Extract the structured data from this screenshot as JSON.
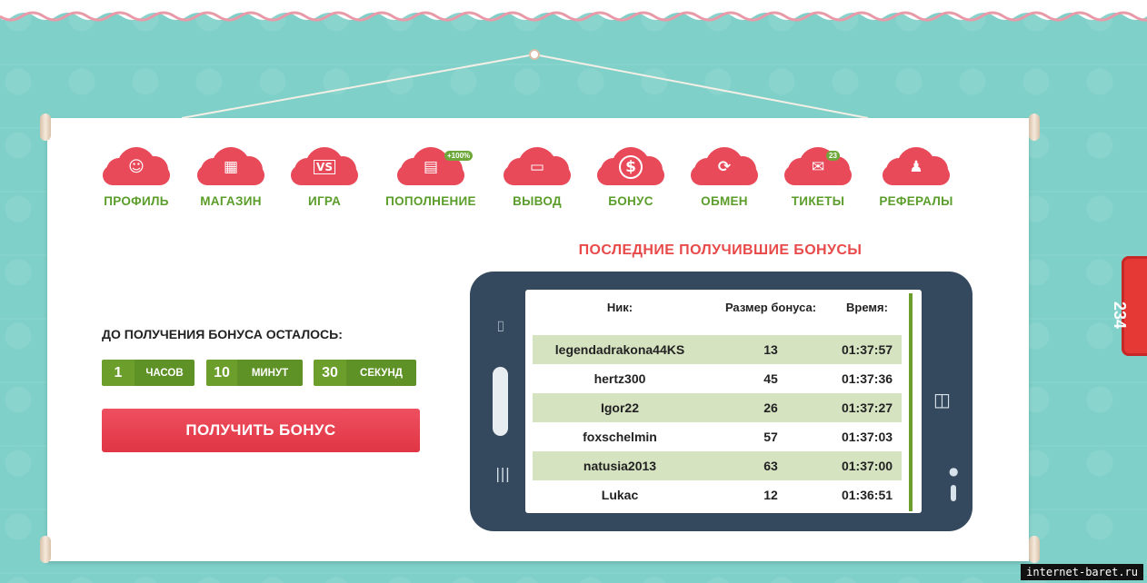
{
  "nav": [
    {
      "label": "ПРОФИЛЬ",
      "icon": "profile-icon",
      "glyph": "☺"
    },
    {
      "label": "МАГАЗИН",
      "icon": "shop-icon",
      "glyph": "▦"
    },
    {
      "label": "ИГРА",
      "icon": "game-icon",
      "glyph": "VS"
    },
    {
      "label": "ПОПОЛНЕНИЕ",
      "icon": "deposit-icon",
      "glyph": "▤",
      "badge": "+100%"
    },
    {
      "label": "ВЫВОД",
      "icon": "wallet-icon",
      "glyph": "▭"
    },
    {
      "label": "БОНУС",
      "icon": "bonus-icon",
      "glyph": "$"
    },
    {
      "label": "ОБМЕН",
      "icon": "exchange-icon",
      "glyph": "⟳"
    },
    {
      "label": "ТИКЕТЫ",
      "icon": "tickets-icon",
      "glyph": "✉",
      "badge": "23"
    },
    {
      "label": "РЕФЕРАЛЫ",
      "icon": "referrals-icon",
      "glyph": "♟"
    }
  ],
  "timer": {
    "title": "ДО ПОЛУЧЕНИЯ БОНУСА ОСТАЛОСЬ:",
    "hours": "1",
    "hours_label": "ЧАСОВ",
    "minutes": "10",
    "minutes_label": "МИНУТ",
    "seconds": "30",
    "seconds_label": "СЕКУНД"
  },
  "get_bonus_label": "ПОЛУЧИТЬ БОНУС",
  "recent": {
    "title": "ПОСЛЕДНИЕ ПОЛУЧИВШИЕ БОНУСЫ",
    "headers": {
      "nick": "Ник:",
      "amount": "Размер бонуса:",
      "time": "Время:"
    },
    "rows": [
      {
        "nick": "legendadrakona44KS",
        "amount": "13",
        "time": "01:37:57"
      },
      {
        "nick": "hertz300",
        "amount": "45",
        "time": "01:37:36"
      },
      {
        "nick": "Igor22",
        "amount": "26",
        "time": "01:37:27"
      },
      {
        "nick": "foxschelmin",
        "amount": "57",
        "time": "01:37:03"
      },
      {
        "nick": "natusia2013",
        "amount": "63",
        "time": "01:37:00"
      },
      {
        "nick": "Lukac",
        "amount": "12",
        "time": "01:36:51"
      }
    ]
  },
  "side_tab": "234",
  "watermark": "internet-baret.ru",
  "colors": {
    "accent_red": "#e84a5a",
    "green": "#5b9d2a",
    "phone": "#34495e",
    "background": "#7fd0c9"
  }
}
